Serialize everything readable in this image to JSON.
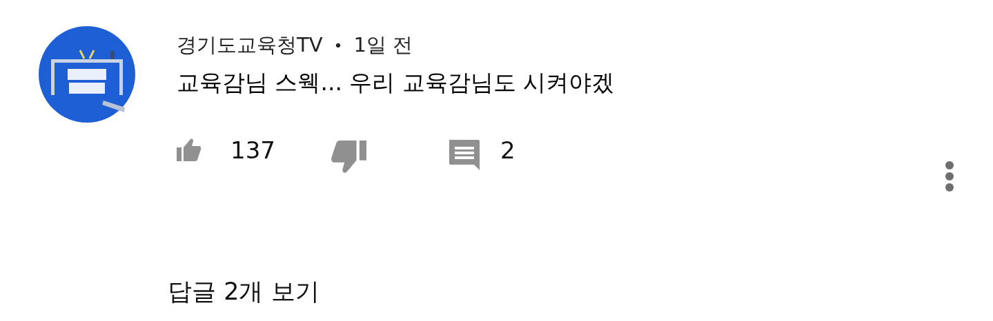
{
  "comment": {
    "author": "경기도교육청TV",
    "separator": "•",
    "time": "1일 전",
    "text": "교육감님 스웩... 우리 교육감님도 시켜야겠",
    "likes": "137",
    "replies": "2"
  },
  "view_replies": "답글 2개 보기"
}
